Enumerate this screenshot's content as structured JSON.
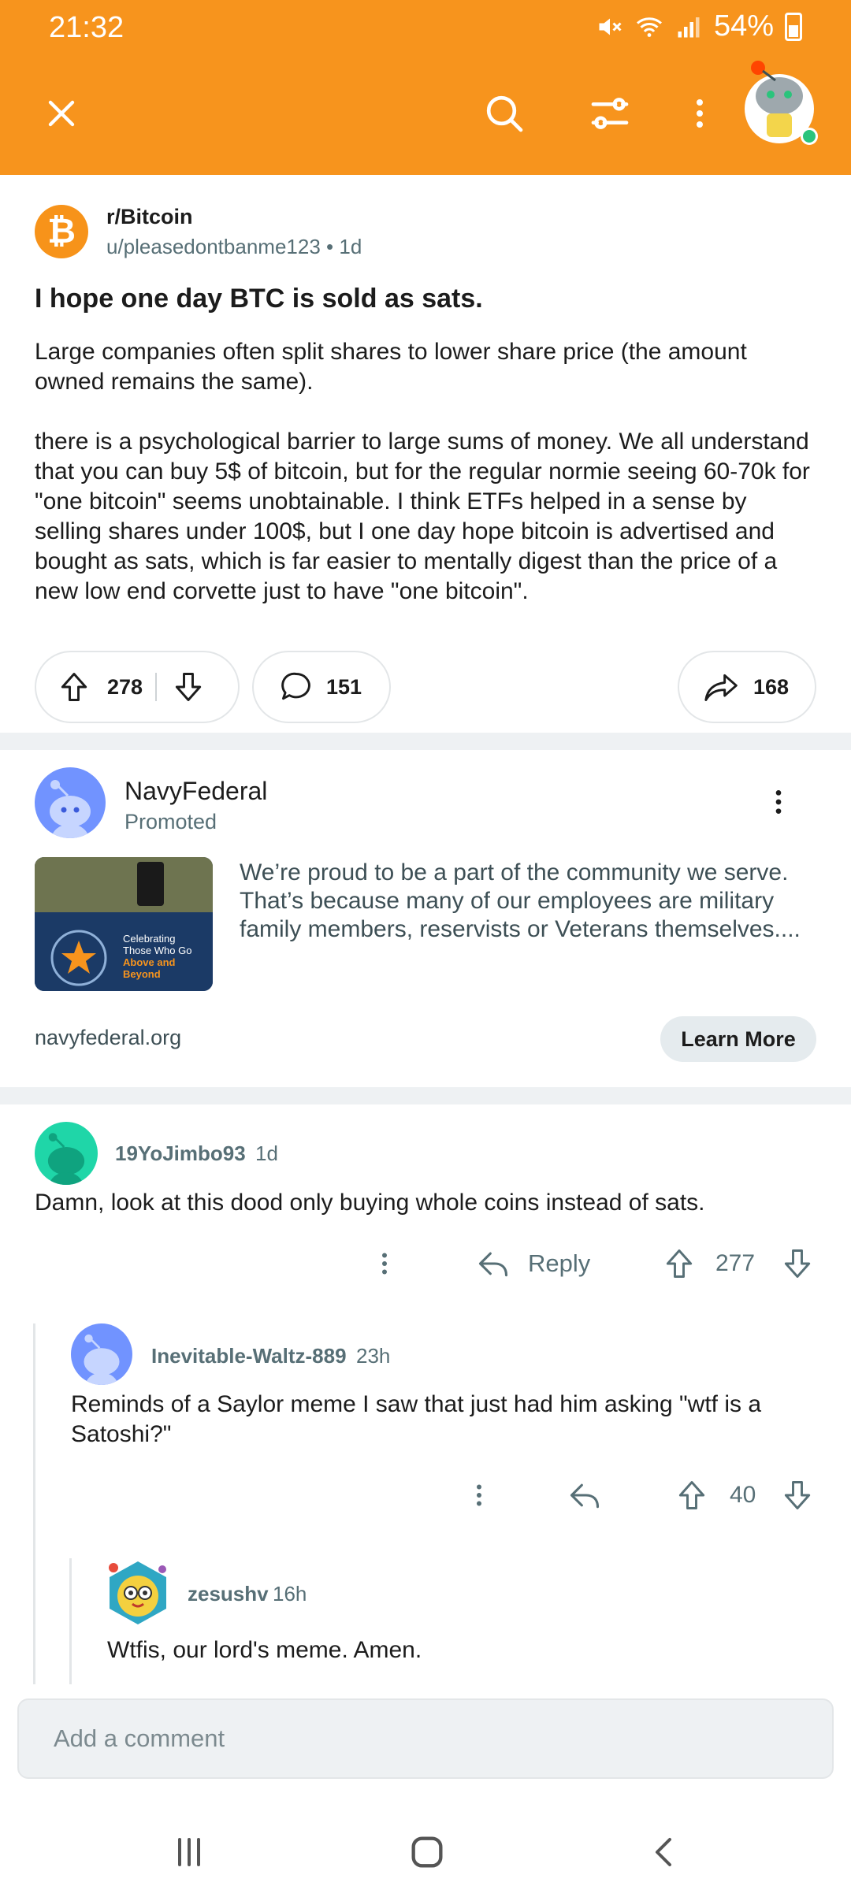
{
  "status": {
    "time": "21:32",
    "battery": "54%"
  },
  "header": {
    "icons": [
      "close-icon",
      "search-icon",
      "filter-icon",
      "more-vertical-icon",
      "user-avatar"
    ]
  },
  "post": {
    "subreddit": "r/Bitcoin",
    "author": "u/pleasedontbanme123",
    "separator": "•",
    "age": "1d",
    "title": "I hope one day BTC is sold as sats.",
    "body": "Large companies often split shares to lower share price (the amount owned remains the same).\n\nthere is a psychological barrier to large sums of money.  We all understand that you can buy 5$ of bitcoin, but for the regular normie seeing 60-70k for \"one bitcoin\" seems unobtainable. I think ETFs helped in a sense by selling shares under 100$, but  I one day hope bitcoin is advertised and bought as sats, which is far easier to mentally digest than the price of a new low end corvette just to have \"one bitcoin\".",
    "upvotes": "278",
    "comments": "151",
    "shares": "168",
    "subreddit_icon": "₿"
  },
  "ad": {
    "advertiser": "NavyFederal",
    "promoted_label": "Promoted",
    "text": "We’re proud to be a part of the community we serve. That’s because many of our employees are military family members, reservists or Veterans themselves....",
    "domain": "navyfederal.org",
    "cta": "Learn More",
    "image_text_line1": "Celebrating",
    "image_text_line2": "Those Who Go",
    "image_text_line3": "Above and",
    "image_text_line4": "Beyond"
  },
  "comments": [
    {
      "author": "19YoJimbo93",
      "age": "1d",
      "text": "Damn, look at this dood only buying whole coins instead of sats.",
      "reply_label": "Reply",
      "votes": "277",
      "avatar_color": "#1fd6a8"
    },
    {
      "author": "Inevitable-Waltz-889",
      "age": "23h",
      "text": "Reminds of a Saylor meme I saw that just had him asking \"wtf is a Satoshi?\"",
      "votes": "40",
      "avatar_color": "#7193ff"
    },
    {
      "author": "zesushv",
      "age": "16h",
      "text": "Wtfis, our lord's meme. Amen."
    }
  ],
  "composer": {
    "placeholder": "Add a comment"
  },
  "colors": {
    "brand": "#f7941d",
    "bitcoin": "#f7931a",
    "muted_text": "#576f76"
  }
}
